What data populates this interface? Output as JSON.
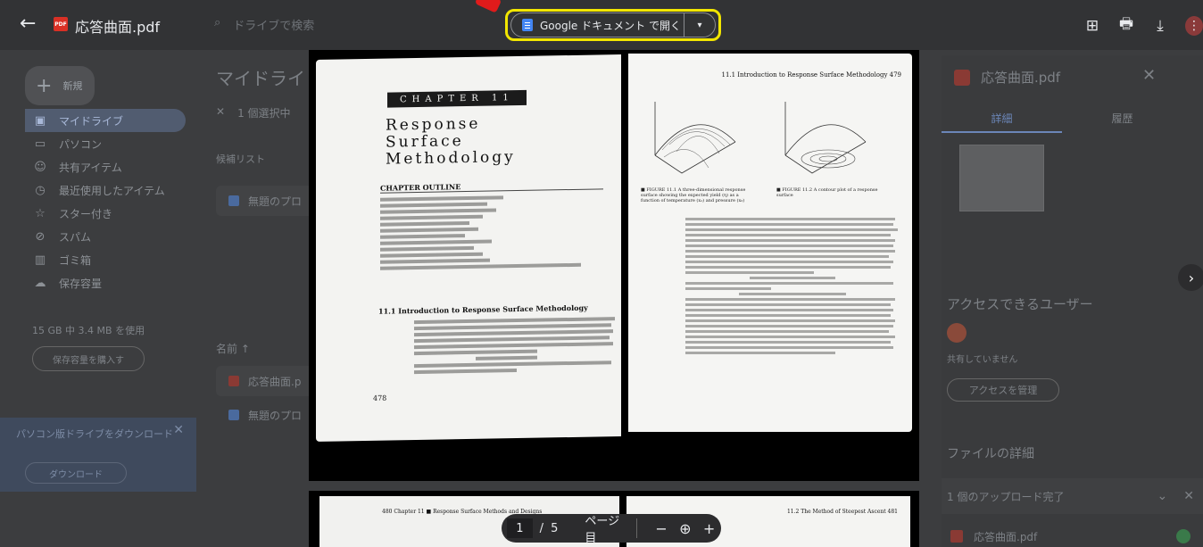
{
  "viewer": {
    "file_name": "応答曲面.pdf",
    "search_placeholder": "ドライブで検索",
    "open_with_label": "Google ドキュメント で開く",
    "dropdown_glyph": "▾",
    "pdf_icon_text": "PDF",
    "back_glyph": "←"
  },
  "toolbar_icons": [
    {
      "name": "add-to-drive-icon",
      "glyph": "⊞"
    },
    {
      "name": "print-icon",
      "glyph": "🖶"
    },
    {
      "name": "download-icon",
      "glyph": "⤓"
    },
    {
      "name": "more-icon",
      "glyph": "⋮"
    }
  ],
  "drive": {
    "new_label": "新規",
    "nav": [
      {
        "label": "マイドライブ",
        "glyph": "▣",
        "active": true
      },
      {
        "label": "パソコン",
        "glyph": "▭"
      },
      {
        "label": "共有アイテム",
        "glyph": "☺"
      },
      {
        "label": "最近使用したアイテム",
        "glyph": "◷"
      },
      {
        "label": "スター付き",
        "glyph": "☆"
      },
      {
        "label": "スパム",
        "glyph": "⊘"
      },
      {
        "label": "ゴミ箱",
        "glyph": "▥"
      },
      {
        "label": "保存容量",
        "glyph": "☁"
      }
    ],
    "storage_text": "15 GB 中 3.4 MB を使用",
    "storage_button": "保存容量を購入す",
    "promo_text": "パソコン版ドライブをダウンロード",
    "promo_button": "ダウンロード",
    "main_title": "マイドライ",
    "selection_text": "1 個選択中",
    "list_label": "候補リスト",
    "row_1": "無題のプロ",
    "row_2": "応答曲面.p",
    "row_3": "無題のプロ",
    "name_header": "名前 ↑"
  },
  "details_panel": {
    "title": "応答曲面.pdf",
    "tab_details": "詳細",
    "tab_activity": "履歴",
    "access_title": "アクセスできるユーザー",
    "not_shared": "共有していません",
    "manage_access": "アクセスを管理",
    "file_details": "ファイルの詳細",
    "upload_status": "1 個のアップロード完了",
    "upload_file": "応答曲面.pdf"
  },
  "pdf_page": {
    "chapter": "CHAPTER 11",
    "title": "Response\nSurface\nMethodology",
    "outline_header": "CHAPTER OUTLINE",
    "section_heading": "11.1    Introduction to Response Surface Methodology",
    "left_page_number": "478",
    "right_header": "11.1 Introduction to Response Surface Methodology   479",
    "fig1_caption": "■ FIGURE 11.1  A three-dimensional response surface showing the expected yield (η) as a function of temperature (x₁) and pressure (x₂)",
    "fig2_caption": "■ FIGURE 11.2  A contour plot of a response surface",
    "next_left_header": "480   Chapter 11 ■ Response Surface Methods and Designs",
    "next_right_header": "11.2 The Method of Steepest Ascent   481"
  },
  "pager": {
    "current_page": "1",
    "separator": "/",
    "total_pages": "5",
    "page_label": "ページ目",
    "zoom_out": "−",
    "zoom_icon": "⊕",
    "zoom_in": "+"
  },
  "next_glyph": "›"
}
